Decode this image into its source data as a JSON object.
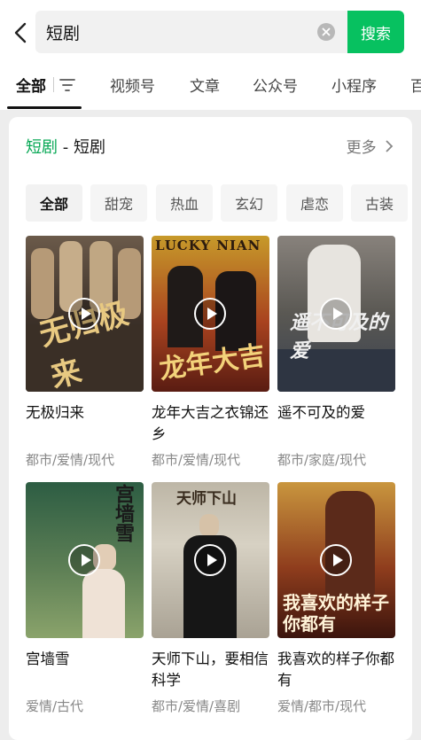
{
  "search": {
    "query": "短剧",
    "button_label": "搜索"
  },
  "tabs": [
    {
      "label": "全部"
    },
    {
      "label": "视频号"
    },
    {
      "label": "文章"
    },
    {
      "label": "公众号"
    },
    {
      "label": "小程序"
    },
    {
      "label": "百"
    }
  ],
  "section": {
    "keyword": "短剧",
    "separator": " - ",
    "title": "短剧",
    "more_label": "更多"
  },
  "categories": [
    "全部",
    "甜宠",
    "热血",
    "玄幻",
    "虐恋",
    "古装"
  ],
  "dramas": [
    {
      "title": "无极归来",
      "tags": "都市/爱情/现代",
      "poster_text": "无归极来"
    },
    {
      "title": "龙年大吉之衣锦还乡",
      "tags": "都市/爱情/现代",
      "poster_text": "龙年大吉",
      "poster_banner": "LUCKY NIAN"
    },
    {
      "title": "遥不可及的爱",
      "tags": "都市/家庭/现代",
      "poster_text": "遥不可及的爱"
    },
    {
      "title": "宫墙雪",
      "tags": "爱情/古代",
      "poster_text": "宫墙雪"
    },
    {
      "title": "天师下山，要相信科学",
      "tags": "都市/爱情/喜剧",
      "poster_text": "天师下山"
    },
    {
      "title": "我喜欢的样子你都有",
      "tags": "爱情/都市/现代",
      "poster_text": "我喜欢的样子你都有"
    }
  ],
  "colors": {
    "accent": "#07c160",
    "keyword": "#07a855"
  }
}
